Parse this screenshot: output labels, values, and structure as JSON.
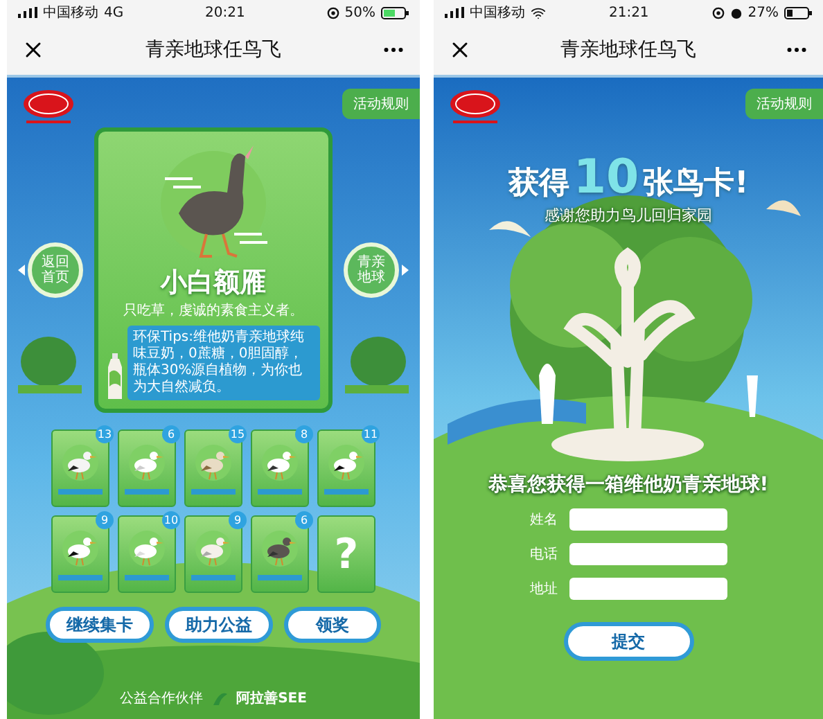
{
  "collection_screen": {
    "status_bar": {
      "carrier": "中国移动",
      "network": "4G",
      "time": "20:21",
      "battery": "50%"
    },
    "nav": {
      "title": "青亲地球任鸟飞"
    },
    "rules_button": "活动规则",
    "side_buttons": [
      {
        "kind": "prev",
        "label": "返回首页"
      },
      {
        "kind": "next",
        "label": "青亲地球"
      }
    ],
    "bird_card": {
      "name": "小白额雁",
      "description": "只吃草，虔诚的素食主义者。",
      "tips": "环保Tips:维他奶青亲地球纯味豆奶，0蔗糖，0胆固醇，瓶体30%源自植物，为你也为大自然减负。"
    },
    "collected_cards": [
      {
        "kind": "bird",
        "count": "13"
      },
      {
        "kind": "bird",
        "count": "6"
      },
      {
        "kind": "bird",
        "count": "15"
      },
      {
        "kind": "bird",
        "count": "8"
      },
      {
        "kind": "bird",
        "count": "11"
      },
      {
        "kind": "bird",
        "count": "9"
      },
      {
        "kind": "bird",
        "count": "10"
      },
      {
        "kind": "bird",
        "count": "9"
      },
      {
        "kind": "bird",
        "count": "6"
      },
      {
        "kind": "unknown",
        "symbol": "?"
      }
    ],
    "buttons": [
      "继续集卡",
      "助力公益",
      "领奖"
    ],
    "footer": {
      "label": "公益合作伙伴",
      "partner": "阿拉善SEE"
    }
  },
  "prize_screen": {
    "status_bar": {
      "carrier": "中国移动",
      "time": "21:21",
      "battery": "27%"
    },
    "nav": {
      "title": "青亲地球任鸟飞"
    },
    "rules_button": "活动规则",
    "headline": {
      "before": "获得",
      "count": "10",
      "after": "张鸟卡!"
    },
    "subtitle": "感谢您助力鸟儿回归家园",
    "congrats": "恭喜您获得一箱维他奶青亲地球!",
    "form_fields": [
      {
        "label": "姓名"
      },
      {
        "label": "电话"
      },
      {
        "label": "地址"
      }
    ],
    "submit": "提交"
  }
}
